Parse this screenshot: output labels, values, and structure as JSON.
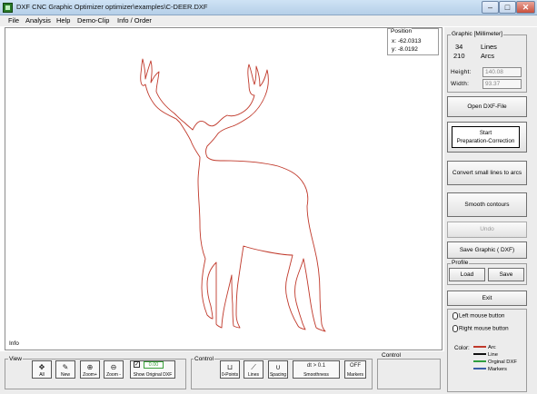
{
  "window": {
    "title": "DXF CNC Graphic Optimizer optimizer\\examples\\C-DEER.DXF",
    "min_label": "–",
    "max_label": "□",
    "close_label": "✕"
  },
  "menu": [
    "File",
    "Analysis",
    "Help",
    "Demo-Clip",
    "Info / Order"
  ],
  "canvas": {
    "position": {
      "title": "Position",
      "x": "x: -62.0313",
      "y": "y: -8.0192"
    },
    "info_label": "Info",
    "shape_color": "#c0392b"
  },
  "panel": {
    "graphic_group": {
      "title": "Graphic [Millimeter]",
      "lines_count": "34",
      "lines_label": "Lines",
      "arcs_count": "210",
      "arcs_label": "Arcs",
      "height_label": "Height:",
      "height_value": "140.08",
      "width_label": "Width:",
      "width_value": "93.37"
    },
    "buttons": {
      "open_dxf": "Open DXF-File",
      "start_line1": "Start",
      "start_line2": "Preparation-Correction",
      "convert_arcs": "Convert small lines to arcs",
      "smooth": "Smooth contours",
      "undo": "Undo",
      "save_graphic": "Save Graphic ( DXF)",
      "profile_title": "Profile",
      "load": "Load",
      "save": "Save",
      "exit": "Exit"
    },
    "mouse": {
      "left": "Left mouse button",
      "right": "Right mouse button"
    },
    "legend": {
      "title": "Color:",
      "items": [
        {
          "label": "Arc",
          "color": "#c0392b"
        },
        {
          "label": "Line",
          "color": "#111111"
        },
        {
          "label": "Orginal DXF",
          "color": "#2e9e3e"
        },
        {
          "label": "Markers",
          "color": "#3b5ea8"
        }
      ]
    }
  },
  "bottom": {
    "view": {
      "title": "View",
      "all": "All",
      "new": "New",
      "zoom_plus": "Zoom+",
      "zoom_minus": "Zoom -",
      "checkbox_value": "0.00",
      "show_original": "Show Original DXF"
    },
    "control": {
      "title": "Control",
      "points": "0-Points",
      "lines": "Lines",
      "spacing": "Spacing",
      "smoothness_threshold": "dt > 0.1",
      "smoothness": "Smoothness",
      "markers_toggle": "OFF",
      "markers": "Markers"
    },
    "control2_title": "Control"
  }
}
